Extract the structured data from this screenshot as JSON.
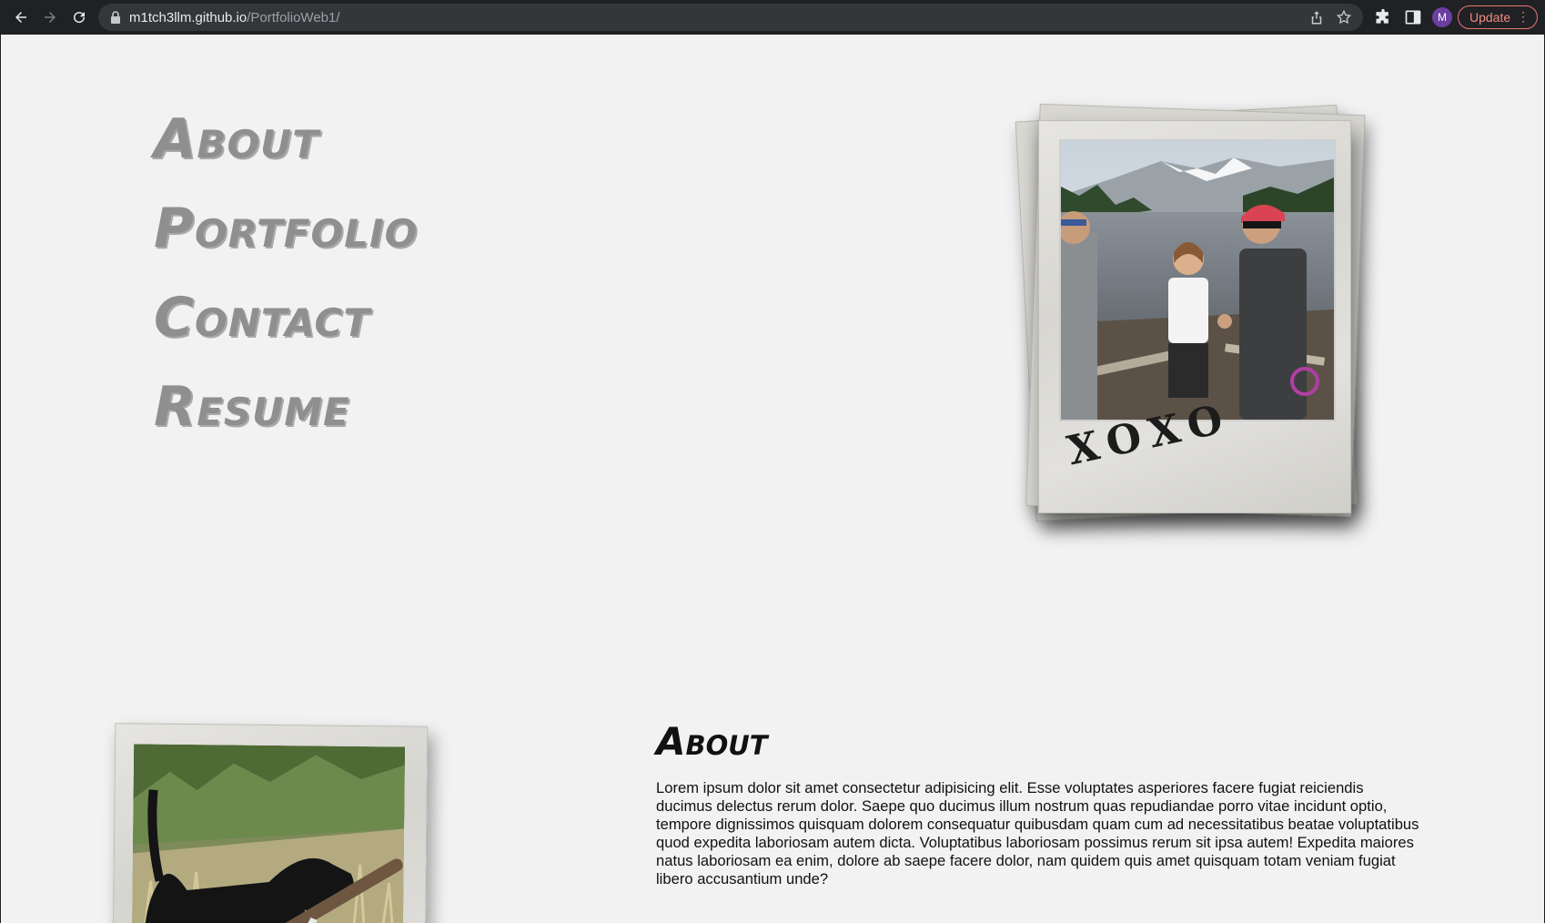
{
  "browser": {
    "url_host": "m1tch3llm.github.io",
    "url_path": "/PortfolioWeb1/",
    "profile_initial": "M",
    "update_label": "Update"
  },
  "nav": {
    "items": [
      {
        "label": "About"
      },
      {
        "label": "Portfolio"
      },
      {
        "label": "Contact"
      },
      {
        "label": "Resume"
      }
    ]
  },
  "hero": {
    "caption": "XOXO"
  },
  "about": {
    "heading": "About",
    "body": "Lorem ipsum dolor sit amet consectetur adipisicing elit. Esse voluptates asperiores facere fugiat reiciendis ducimus delectus rerum dolor. Saepe quo ducimus illum nostrum quas repudiandae porro vitae incidunt optio, tempore dignissimos quisquam dolorem consequatur quibusdam quam cum ad necessitatibus beatae voluptatibus quod expedita laboriosam autem dicta. Voluptatibus laboriosam possimus rerum sit ipsa autem! Expedita maiores natus laboriosam ea enim, dolore ab saepe facere dolor, nam quidem quis amet quisquam totam veniam fugiat libero accusantium unde?"
  }
}
